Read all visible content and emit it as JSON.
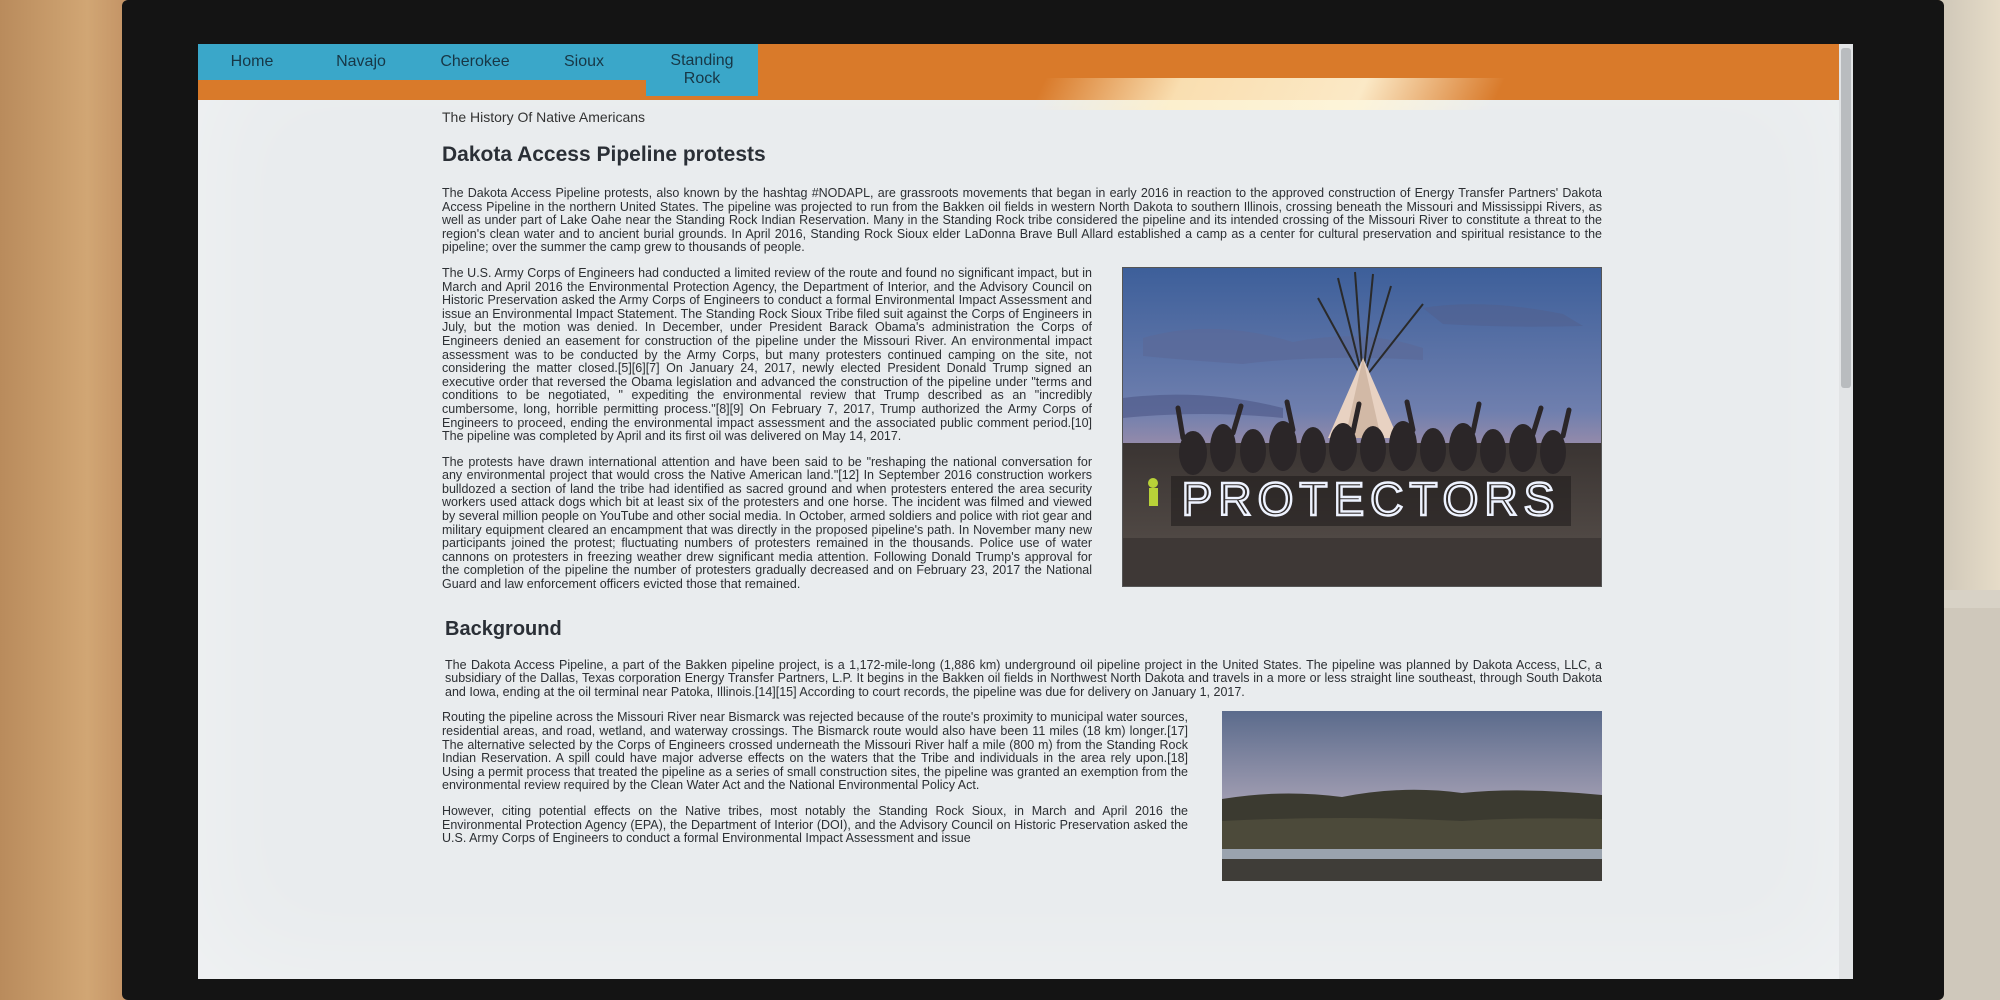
{
  "nav": {
    "items": [
      {
        "label": "Home"
      },
      {
        "label": "Navajo"
      },
      {
        "label": "Cherokee"
      },
      {
        "label": "Sioux"
      },
      {
        "label": "Standing\nRock"
      }
    ]
  },
  "site_title": "The History Of Native Americans",
  "article": {
    "title": "Dakota Access Pipeline protests",
    "intro": "The Dakota Access Pipeline protests, also known by the hashtag #NODAPL, are grassroots movements that began in early 2016 in reaction to the approved construction of Energy Transfer Partners' Dakota Access Pipeline in the northern United States. The pipeline was projected to run from the Bakken oil fields in western North Dakota to southern Illinois, crossing beneath the Missouri and Mississippi Rivers, as well as under part of Lake Oahe near the Standing Rock Indian Reservation. Many in the Standing Rock tribe considered the pipeline and its intended crossing of the Missouri River to constitute a threat to the region's clean water and to ancient burial grounds. In April 2016, Standing Rock Sioux elder LaDonna Brave Bull Allard established a camp as a center for cultural preservation and spiritual resistance to the pipeline; over the summer the camp grew to thousands of people.",
    "para2": "The U.S. Army Corps of Engineers had conducted a limited review of the route and found no significant impact, but in March and April 2016 the Environmental Protection Agency, the Department of Interior, and the Advisory Council on Historic Preservation asked the Army Corps of Engineers to conduct a formal Environmental Impact Assessment and issue an Environmental Impact Statement. The Standing Rock Sioux Tribe filed suit against the Corps of Engineers in July, but the motion was denied. In December, under President Barack Obama's administration the Corps of Engineers denied an easement for construction of the pipeline under the Missouri River. An environmental impact assessment was to be conducted by the Army Corps, but many protesters continued camping on the site, not considering the matter closed.[5][6][7] On January 24, 2017, newly elected President Donald Trump signed an executive order that reversed the Obama legislation and advanced the construction of the pipeline under \"terms and conditions to be negotiated, \" expediting the environmental review that Trump described as an \"incredibly cumbersome, long, horrible permitting process.\"[8][9] On February 7, 2017, Trump authorized the Army Corps of Engineers to proceed, ending the environmental impact assessment and the associated public comment period.[10] The pipeline was completed by April and its first oil was delivered on May 14, 2017.",
    "para3": "The protests have drawn international attention and have been said to be \"reshaping the national conversation for any environmental project that would cross the Native American land.\"[12] In September 2016 construction workers bulldozed a section of land the tribe had identified as sacred ground and when protesters entered the area security workers used attack dogs which bit at least six of the protesters and one horse. The incident was filmed and viewed by several million people on YouTube and other social media. In October, armed soldiers and police with riot gear and military equipment cleared an encampment that was directly in the proposed pipeline's path. In November many new participants joined the protest; fluctuating numbers of protesters remained in the thousands. Police use of water cannons on protesters in freezing weather drew significant media attention. Following Donald Trump's approval for the completion of the pipeline the number of protesters gradually decreased and on February 23, 2017 the National Guard and law enforcement officers evicted those that remained.",
    "image1_sign": "PROTECTORS"
  },
  "background": {
    "heading": "Background",
    "para1": "The Dakota Access Pipeline, a part of the Bakken pipeline project, is a 1,172-mile-long (1,886 km) underground oil pipeline project in the United States. The pipeline was planned by Dakota Access, LLC, a subsidiary of the Dallas, Texas corporation Energy Transfer Partners, L.P. It begins in the Bakken oil fields in Northwest North Dakota and travels in a more or less straight line southeast, through South Dakota and Iowa, ending at the oil terminal near Patoka, Illinois.[14][15] According to court records, the pipeline was due for delivery on January 1, 2017.",
    "para2": "Routing the pipeline across the Missouri River near Bismarck was rejected because of the route's proximity to municipal water sources, residential areas, and road, wetland, and waterway crossings. The Bismarck route would also have been 11 miles (18 km) longer.[17] The alternative selected by the Corps of Engineers crossed underneath the Missouri River half a mile (800 m) from the Standing Rock Indian Reservation. A spill could have major adverse effects on the waters that the Tribe and individuals in the area rely upon.[18] Using a permit process that treated the pipeline as a series of small construction sites, the pipeline was granted an exemption from the environmental review required by the Clean Water Act and the National Environmental Policy Act.",
    "para3": "However, citing potential effects on the Native tribes, most notably the Standing Rock Sioux, in March and April 2016 the Environmental Protection Agency (EPA), the Department of Interior (DOI), and the Advisory Council on Historic Preservation asked the U.S. Army Corps of Engineers to conduct a formal Environmental Impact Assessment and issue"
  },
  "colors": {
    "nav_orange": "#d97a2a",
    "nav_blue": "#3aa7c9",
    "nav_text": "#173746",
    "page_bg": "#e9ecee"
  }
}
